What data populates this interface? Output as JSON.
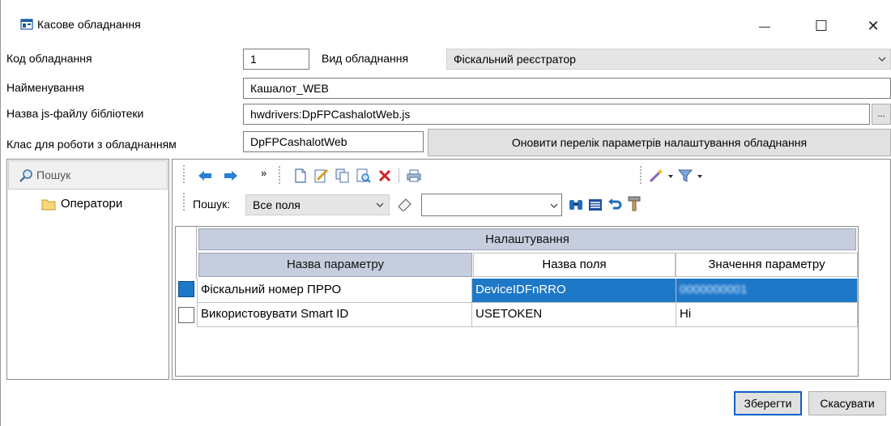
{
  "window": {
    "title": "Касове обладнання",
    "controls": {
      "minimize": "—",
      "maximize": "☐",
      "close": "✕"
    }
  },
  "form": {
    "code_label": "Код обладнання",
    "code_value": "1",
    "type_label": "Вид обладнання",
    "type_value": "Фіскальний реєстратор",
    "name_label": "Найменування",
    "name_value": "Кашалот_WEB",
    "js_label": "Назва js-файлу бібліотеки",
    "js_value": "hwdrivers:DpFPCashalotWeb.js",
    "browse_label": "...",
    "class_label": "Клас для роботи з обладнанням",
    "class_value": "DpFPCashalotWeb",
    "refresh_button": "Оновити перелік параметрів налаштування обладнання"
  },
  "left_panel": {
    "search_label": "Пошук",
    "tree_items": [
      "Оператори"
    ]
  },
  "toolbar": {
    "search_label": "Пошук:",
    "field_select": "Все поля",
    "search_value": "",
    "more": "»"
  },
  "grid": {
    "group_header": "Налаштування",
    "columns": [
      "Назва параметру",
      "Назва поля",
      "Значення параметру"
    ],
    "rows": [
      {
        "name": "Фіскальний номер ПРРО",
        "field": "DeviceIDFnRRO",
        "value": "0000000001",
        "selected": true
      },
      {
        "name": "Використовувати Smart ID",
        "field": "USETOKEN",
        "value": "Ні",
        "selected": false
      }
    ]
  },
  "footer": {
    "save_button": "Зберегти",
    "cancel_button": "Скасувати"
  },
  "colors": {
    "selection": "#1e78c8",
    "header": "#c6cede",
    "toolbar_blue": "#2a7fd4",
    "delete_red": "#d42020"
  }
}
